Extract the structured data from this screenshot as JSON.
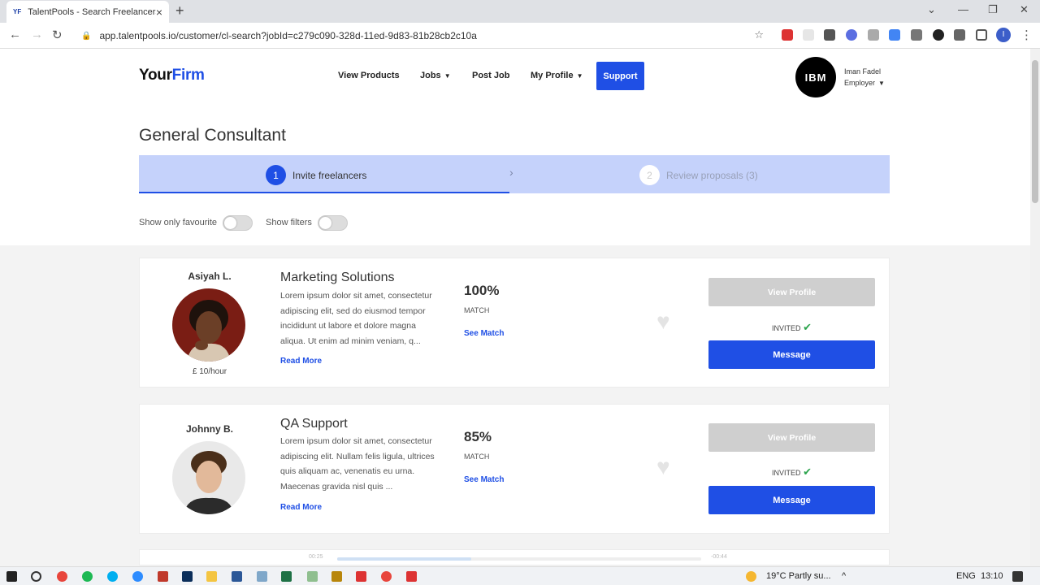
{
  "browser": {
    "tab_title": "TalentPools - Search Freelancers",
    "tab_favicon": "YF",
    "url": "app.talentpools.io/customer/cl-search?jobId=c279c090-328d-11ed-9d83-81b28cb2c10a"
  },
  "header": {
    "logo_part1": "Your",
    "logo_part2": "Firm",
    "nav": {
      "view_products": "View Products",
      "jobs": "Jobs",
      "post_job": "Post Job",
      "my_profile": "My Profile",
      "support": "Support"
    },
    "user": {
      "avatar_text": "IBM",
      "name": "Iman Fadel",
      "role": "Employer"
    }
  },
  "page": {
    "title": "General Consultant",
    "steps": [
      {
        "num": "1",
        "label": "Invite freelancers"
      },
      {
        "num": "2",
        "label": "Review proposals (3)"
      }
    ],
    "filters": {
      "favourite_label": "Show only favourite",
      "filters_label": "Show filters"
    }
  },
  "cards": [
    {
      "name": "Asiyah L.",
      "rate": "£ 10/hour",
      "job_title": "Marketing Solutions",
      "description": "Lorem ipsum dolor sit amet, consectetur adipiscing elit, sed do eiusmod tempor incididunt ut labore et dolore magna aliqua. Ut enim ad minim veniam, q...",
      "read_more": "Read More",
      "match_pct": "100%",
      "match_label": "MATCH",
      "see_match": "See Match",
      "view_profile": "View Profile",
      "invited": "INVITED",
      "message": "Message"
    },
    {
      "name": "Johnny B.",
      "rate": "",
      "job_title": "QA Support",
      "description": "Lorem ipsum dolor sit amet, consectetur adipiscing elit. Nullam felis ligula, ultrices quis aliquam ac, venenatis eu urna. Maecenas gravida nisl quis ...",
      "read_more": "Read More",
      "match_pct": "85%",
      "match_label": "MATCH",
      "see_match": "See Match",
      "view_profile": "View Profile",
      "invited": "INVITED",
      "message": "Message"
    }
  ],
  "media": {
    "elapsed": "00:25",
    "remaining": "-00:44"
  },
  "taskbar": {
    "weather": "19°C  Partly su...",
    "lang": "ENG",
    "time": "13:10"
  },
  "colors": {
    "brand": "#1f4fe5",
    "step_bar": "#c5d2fb",
    "invited_tick": "#2ca44d"
  }
}
